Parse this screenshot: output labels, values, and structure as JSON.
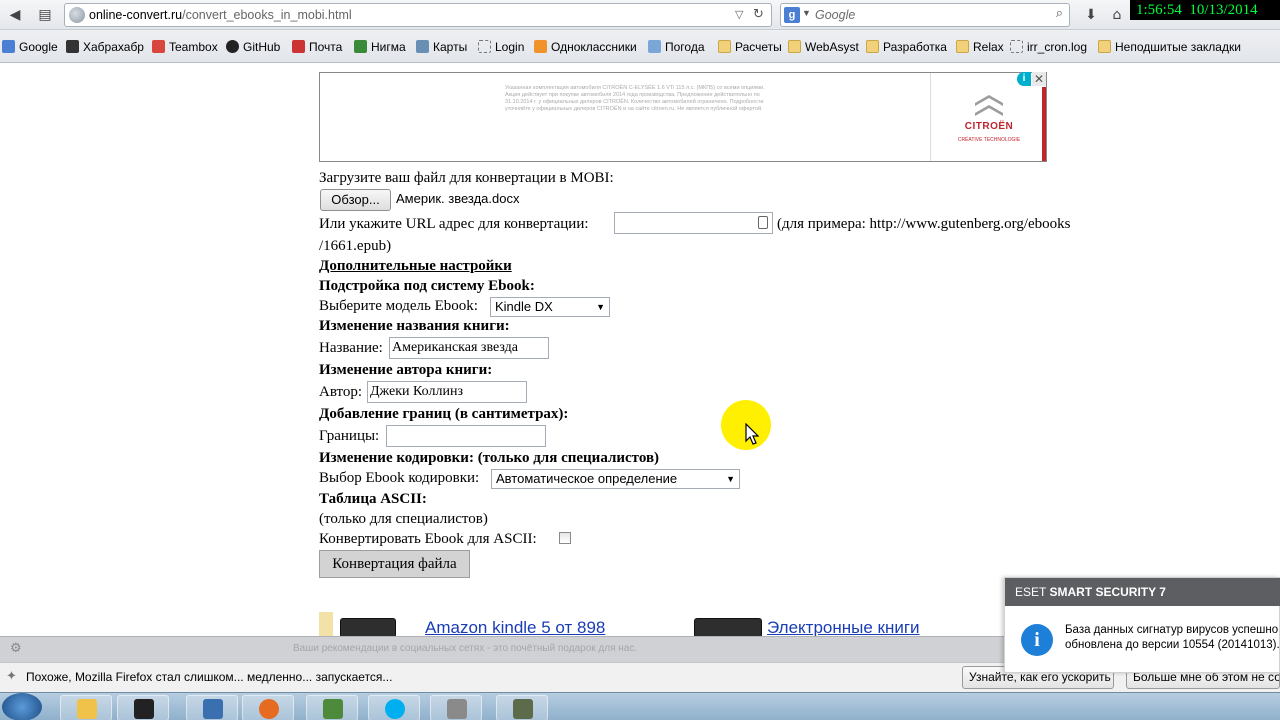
{
  "browser": {
    "url_host": "online-convert.ru",
    "url_path": "/convert_ebooks_in_mobi.html",
    "search_placeholder": "Google",
    "search_engine_letter": "g"
  },
  "clock": {
    "time": "1:56:54",
    "date": "10/13/2014"
  },
  "bookmarks": [
    "Google",
    "Хабрахабр",
    "Teambox",
    "GitHub",
    "Почта",
    "Нигма",
    "Карты",
    "Login",
    "Одноклассники",
    "Погода",
    "Расчеты",
    "WebAsyst",
    "Разработка",
    "Relax",
    "irr_cron.log",
    "Неподшитые закладки"
  ],
  "ad": {
    "brand": "CITROËN",
    "tagline": "CRÉATIVE TECHNOLOGIE",
    "info_label": "i",
    "close_label": "✕",
    "body": "Указанная комплектация автомобиля CITROËN C-ELYSÉE 1.6 VTi 115 л.с. (МКП5) со всеми опциями. Акция действует при покупке автомобиля 2014 года производства. Предложение действительно по 31.10.2014 г. у официальных дилеров CITROËN. Количество автомобилей ограничено. Подробности уточняйте у официальных дилеров CITROËN и на сайте citroen.ru. Не является публичной офертой."
  },
  "form": {
    "upload_label": "Загрузите ваш файл для конвертации в MOBI:",
    "browse_button": "Обзор...",
    "file_name": "Америк. звезда.docx",
    "url_label": "Или укажите URL адрес для конвертации:",
    "url_value": "",
    "url_example_1": "(для примера: http://www.gutenberg.org/ebooks",
    "url_example_2": "/1661.epub)",
    "advanced_heading": "Дополнительные настройки",
    "ebook_system_heading": "Подстройка под систему Ebook:",
    "ebook_model_label": "Выберите модель Ebook:",
    "ebook_model_value": "Kindle DX",
    "title_heading": "Изменение названия книги:",
    "title_label": "Название:",
    "title_value": "Американская звезда",
    "author_heading": "Изменение автора книги:",
    "author_label": "Автор:",
    "author_value": "Джеки Коллинз",
    "margins_heading": "Добавление границ (в сантиметрах):",
    "margins_label": "Границы:",
    "margins_value": "",
    "encoding_heading": "Изменение кодировки: (только для специалистов)",
    "encoding_label": "Выбор Ebook кодировки:",
    "encoding_value": "Автоматическое определение",
    "ascii_heading": "Таблица ASCII:",
    "ascii_note": "(только для специалистов)",
    "ascii_checkbox_label": "Конвертировать Ebook для ASCII:",
    "ascii_checked": false,
    "convert_button": "Конвертация файла"
  },
  "products": [
    {
      "label": "Amazon kindle 5 от 898"
    },
    {
      "label": "Электронные книги"
    }
  ],
  "social_bar_text": "Ваши рекомендации в социальных сетях - это почётный подарок для нас.",
  "notification": {
    "message": "Похоже, Mozilla Firefox стал слишком... медленно... запускается...",
    "btn_speedup": "Узнайте, как его ускорить",
    "btn_dismiss": "Больше мне об этом не сообщать"
  },
  "eset": {
    "brand_light": "ESET",
    "brand_bold": "SMART SECURITY 7",
    "line1": "База данных сигнатур вирусов успешно",
    "line2": "обновлена до версии 10554 (20141013)."
  },
  "colors": {
    "link": "#1a3cb5",
    "clock_text": "#00ff3a",
    "brand_red": "#c0242c",
    "cursor_highlight": "#ffef00"
  }
}
